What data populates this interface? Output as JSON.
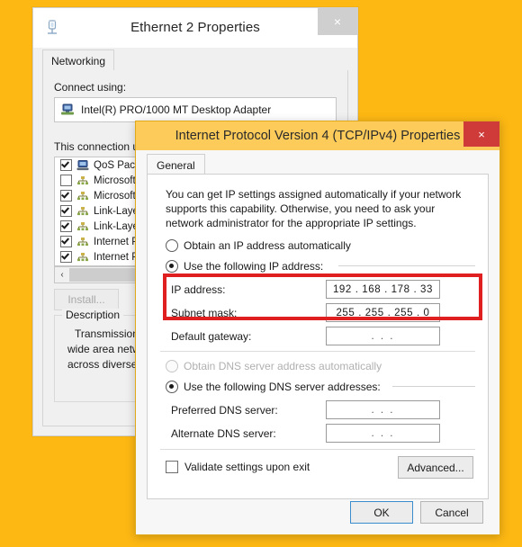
{
  "desktop": {
    "background_color": "#FDB813"
  },
  "back_window": {
    "title": "Ethernet 2 Properties",
    "close_label": "×",
    "icon": "network-adapter-icon",
    "tabs": [
      {
        "label": "Networking"
      }
    ],
    "connect_using_label": "Connect using:",
    "adapter": "Intel(R) PRO/1000 MT Desktop Adapter",
    "connection_uses_label": "This connection us",
    "items": [
      {
        "label": "QoS Pack",
        "checked": true,
        "icon": "computer-icon"
      },
      {
        "label": "Microsoft",
        "checked": false,
        "icon": "protocol-icon"
      },
      {
        "label": "Microsoft",
        "checked": true,
        "icon": "protocol-icon"
      },
      {
        "label": "Link-Layer",
        "checked": true,
        "icon": "protocol-icon"
      },
      {
        "label": "Link-Layer",
        "checked": true,
        "icon": "protocol-icon"
      },
      {
        "label": "Internet Pr",
        "checked": true,
        "icon": "protocol-icon"
      },
      {
        "label": "Internet Pr",
        "checked": true,
        "icon": "protocol-icon"
      }
    ],
    "scroll_left_glyph": "‹",
    "install_button": "Install...",
    "description_group": "Description",
    "description_lines": [
      "Transmission Co",
      "wide area netwo",
      "across diverse in"
    ]
  },
  "front_window": {
    "title": "Internet Protocol Version 4 (TCP/IPv4) Properties",
    "close_label": "×",
    "tabs": [
      {
        "label": "General"
      }
    ],
    "intro": "You can get IP settings assigned automatically if your network supports this capability. Otherwise, you need to ask your network administrator for the appropriate IP settings.",
    "ip_section": {
      "radio_auto": {
        "label": "Obtain an IP address automatically",
        "selected": false,
        "disabled": false
      },
      "radio_manual": {
        "label": "Use the following IP address:",
        "selected": true,
        "disabled": false
      },
      "fields": [
        {
          "label": "IP address:",
          "value": "192 . 168 . 178 . 33",
          "empty": false
        },
        {
          "label": "Subnet mask:",
          "value": "255 . 255 . 255 .  0",
          "empty": false
        },
        {
          "label": "Default gateway:",
          "value": ".     .     .",
          "empty": true
        }
      ],
      "highlight_color": "#E02020"
    },
    "dns_section": {
      "radio_auto": {
        "label": "Obtain DNS server address automatically",
        "selected": false,
        "disabled": true
      },
      "radio_manual": {
        "label": "Use the following DNS server addresses:",
        "selected": true,
        "disabled": false
      },
      "fields": [
        {
          "label": "Preferred DNS server:",
          "value": ".     .     .",
          "empty": true
        },
        {
          "label": "Alternate DNS server:",
          "value": ".     .     .",
          "empty": true
        }
      ]
    },
    "validate_checkbox": {
      "label": "Validate settings upon exit",
      "checked": false
    },
    "advanced_button": "Advanced...",
    "ok_button": "OK",
    "cancel_button": "Cancel"
  }
}
